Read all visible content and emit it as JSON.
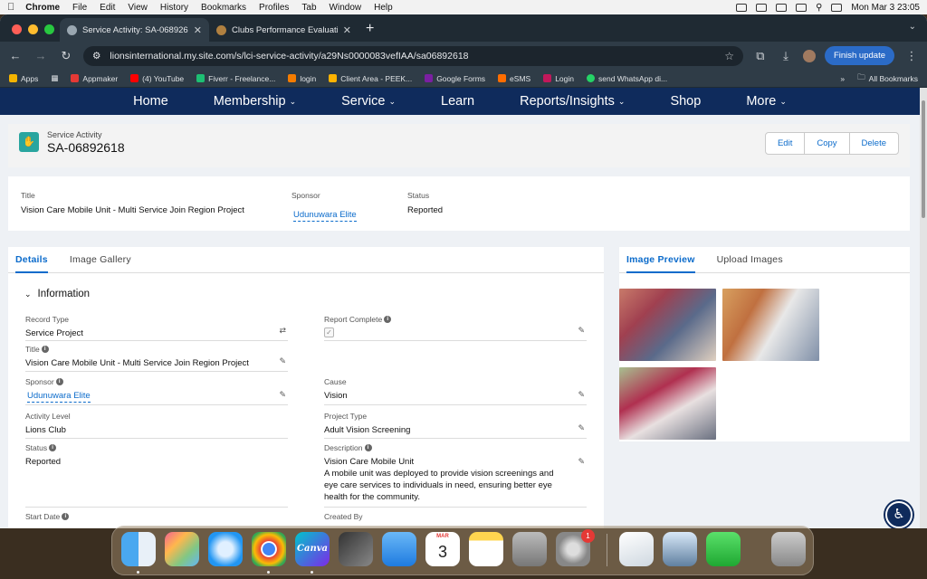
{
  "menubar": {
    "app": "Chrome",
    "items": [
      "File",
      "Edit",
      "View",
      "History",
      "Bookmarks",
      "Profiles",
      "Tab",
      "Window",
      "Help"
    ],
    "clock": "Mon Mar 3  23:05"
  },
  "browser": {
    "tabs": [
      {
        "title": "Service Activity: SA-068926"
      },
      {
        "title": "Clubs Performance Evaluation"
      }
    ],
    "url": "lionsinternational.my.site.com/s/lci-service-activity/a29Ns0000083vefIAA/sa06892618",
    "finish_update": "Finish update",
    "bookmarks": [
      {
        "label": "Apps",
        "color": "#f4b400"
      },
      {
        "label": "Appmaker",
        "color": "#e53935"
      },
      {
        "label": "(4) YouTube",
        "color": "#ff0000"
      },
      {
        "label": "Fiverr - Freelance...",
        "color": "#1dbf73"
      },
      {
        "label": "login",
        "color": "#f57c00"
      },
      {
        "label": "Client Area - PEEK...",
        "color": "#ffb300"
      },
      {
        "label": "Google Forms",
        "color": "#7b1fa2"
      },
      {
        "label": "eSMS",
        "color": "#ff6d00"
      },
      {
        "label": "Login",
        "color": "#c2185b"
      },
      {
        "label": "send WhatsApp di...",
        "color": "#25d366"
      }
    ],
    "all_bookmarks": "All Bookmarks"
  },
  "site_nav": [
    {
      "label": "Home",
      "caret": ""
    },
    {
      "label": "Membership",
      "caret": "⌄"
    },
    {
      "label": "Service",
      "caret": "⌄"
    },
    {
      "label": "Learn",
      "caret": ""
    },
    {
      "label": "Reports/Insights",
      "caret": "⌄"
    },
    {
      "label": "Shop",
      "caret": ""
    },
    {
      "label": "More",
      "caret": "⌄"
    }
  ],
  "record": {
    "object_type": "Service Activity",
    "name": "SA-06892618",
    "actions": {
      "edit": "Edit",
      "copy": "Copy",
      "delete": "Delete"
    }
  },
  "highlights": {
    "title_label": "Title",
    "title_value": "Vision Care Mobile Unit - Multi Service Join Region Project",
    "sponsor_label": "Sponsor",
    "sponsor_value": "Udunuwara Elite",
    "status_label": "Status",
    "status_value": "Reported"
  },
  "details": {
    "tabs": [
      "Details",
      "Image Gallery"
    ],
    "section": "Information",
    "record_type": {
      "label": "Record Type",
      "value": "Service Project"
    },
    "report_complete": {
      "label": "Report Complete",
      "checked": "✓"
    },
    "title": {
      "label": "Title",
      "value": "Vision Care Mobile Unit - Multi Service Join Region Project"
    },
    "sponsor": {
      "label": "Sponsor",
      "value": "Udunuwara Elite"
    },
    "cause": {
      "label": "Cause",
      "value": "Vision"
    },
    "activity_level": {
      "label": "Activity Level",
      "value": "Lions Club"
    },
    "project_type": {
      "label": "Project Type",
      "value": "Adult Vision Screening"
    },
    "status": {
      "label": "Status",
      "value": "Reported"
    },
    "description": {
      "label": "Description",
      "value_line1": "Vision Care Mobile Unit",
      "value_line2": "A mobile unit was deployed to provide vision screenings and",
      "value_line3": "eye care services to individuals in need, ensuring better eye",
      "value_line4": "health for the community."
    },
    "start_date": {
      "label": "Start Date"
    },
    "created_by": {
      "label": "Created By"
    }
  },
  "image_panel": {
    "tabs": [
      "Image Preview",
      "Upload Images"
    ]
  },
  "dock": {
    "calendar_month": "MAR",
    "calendar_day": "3",
    "canva": "Canva",
    "settings_badge": "1"
  },
  "colors": {
    "brand_nav": "#0f2b5c",
    "link": "#0b6bcb",
    "record_icon": "#29a59f"
  }
}
